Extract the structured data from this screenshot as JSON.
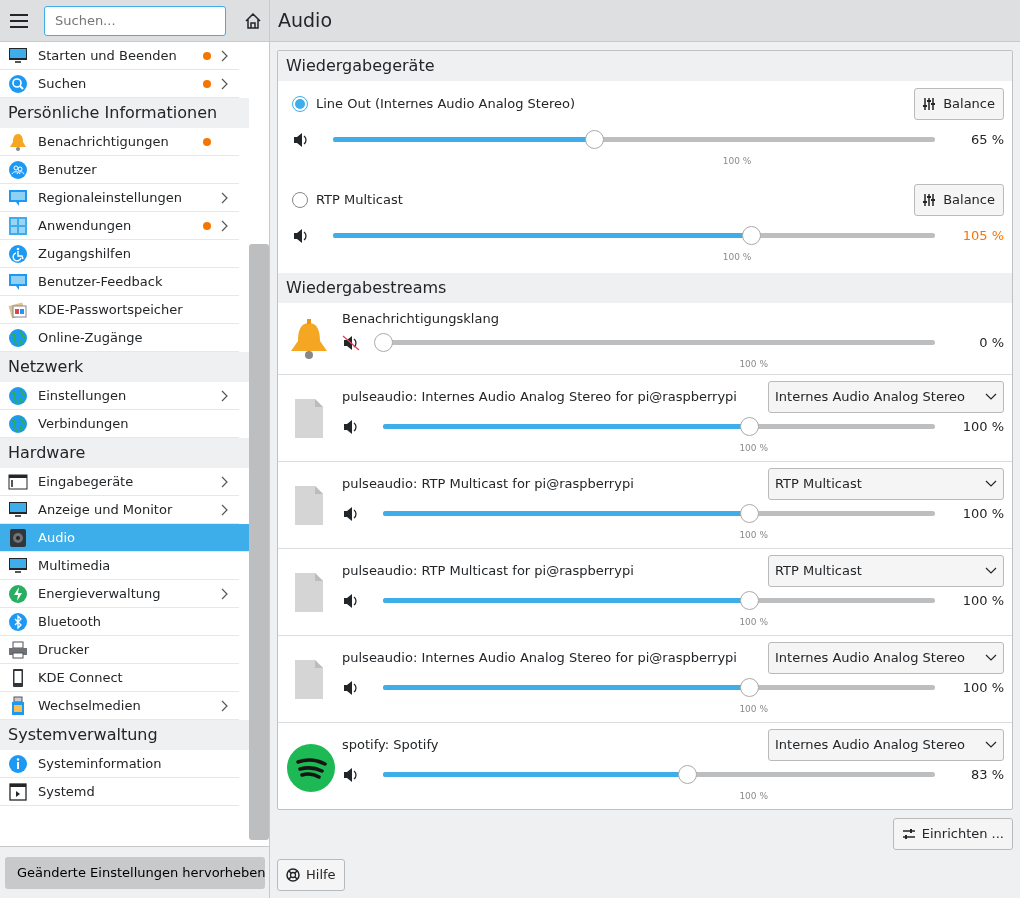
{
  "toolbar": {
    "search": {
      "placeholder": "Suchen..."
    }
  },
  "page_title": "Audio",
  "sidebar": {
    "groups": [
      {
        "items": [
          {
            "label": "Starten und Beenden",
            "notify": true,
            "chevron": true,
            "selected": false
          },
          {
            "label": "Suchen",
            "notify": true,
            "chevron": true,
            "selected": false
          }
        ]
      },
      {
        "title": "Persönliche Informationen",
        "items": [
          {
            "label": "Benachrichtigungen",
            "notify": true,
            "chevron": false,
            "selected": false
          },
          {
            "label": "Benutzer",
            "notify": false,
            "chevron": false,
            "selected": false
          },
          {
            "label": "Regionaleinstellungen",
            "notify": false,
            "chevron": true,
            "selected": false
          },
          {
            "label": "Anwendungen",
            "notify": true,
            "chevron": true,
            "selected": false
          },
          {
            "label": "Zugangshilfen",
            "notify": false,
            "chevron": false,
            "selected": false
          },
          {
            "label": "Benutzer-Feedback",
            "notify": false,
            "chevron": false,
            "selected": false
          },
          {
            "label": "KDE-Passwortspeicher",
            "notify": false,
            "chevron": false,
            "selected": false
          },
          {
            "label": "Online-Zugänge",
            "notify": false,
            "chevron": false,
            "selected": false
          }
        ]
      },
      {
        "title": "Netzwerk",
        "items": [
          {
            "label": "Einstellungen",
            "notify": false,
            "chevron": true,
            "selected": false
          },
          {
            "label": "Verbindungen",
            "notify": false,
            "chevron": false,
            "selected": false
          }
        ]
      },
      {
        "title": "Hardware",
        "items": [
          {
            "label": "Eingabegeräte",
            "notify": false,
            "chevron": true,
            "selected": false
          },
          {
            "label": "Anzeige und Monitor",
            "notify": false,
            "chevron": true,
            "selected": false
          },
          {
            "label": "Audio",
            "notify": false,
            "chevron": false,
            "selected": true
          },
          {
            "label": "Multimedia",
            "notify": false,
            "chevron": false,
            "selected": false
          },
          {
            "label": "Energieverwaltung",
            "notify": false,
            "chevron": true,
            "selected": false
          },
          {
            "label": "Bluetooth",
            "notify": false,
            "chevron": false,
            "selected": false
          },
          {
            "label": "Drucker",
            "notify": false,
            "chevron": false,
            "selected": false
          },
          {
            "label": "KDE Connect",
            "notify": false,
            "chevron": false,
            "selected": false
          },
          {
            "label": "Wechselmedien",
            "notify": false,
            "chevron": true,
            "selected": false
          }
        ]
      },
      {
        "title": "Systemverwaltung",
        "items": [
          {
            "label": "Systeminformation",
            "notify": false,
            "chevron": false,
            "selected": false
          },
          {
            "label": "Systemd",
            "notify": false,
            "chevron": false,
            "selected": false
          }
        ]
      }
    ]
  },
  "devices": {
    "title": "Wiedergabegeräte",
    "items": [
      {
        "label": "Line Out (Internes Audio Analog Stereo)",
        "selected": true,
        "balance": "Balance",
        "muted": false,
        "level": 0.434,
        "reading": "65 %",
        "over": false,
        "mark": "100 %"
      },
      {
        "label": "RTP Multicast",
        "selected": false,
        "balance": "Balance",
        "muted": false,
        "level": 0.695,
        "reading": "105 %",
        "over": true,
        "mark": "100 %"
      }
    ]
  },
  "streams": {
    "title": "Wiedergabestreams",
    "items": [
      {
        "kind": "bell",
        "name": "Benachrichtigungsklang",
        "muted": true,
        "level": 0,
        "reading": "0 %",
        "mark": "100 %"
      },
      {
        "kind": "file",
        "name": "pulseaudio: Internes Audio Analog Stereo for pi@raspberrypi",
        "device": "Internes Audio Analog Stereo",
        "muted": false,
        "level": 0.663,
        "reading": "100 %",
        "mark": "100 %"
      },
      {
        "kind": "file",
        "name": "pulseaudio: RTP Multicast for pi@raspberrypi",
        "device": "RTP Multicast",
        "muted": false,
        "level": 0.663,
        "reading": "100 %",
        "mark": "100 %"
      },
      {
        "kind": "file",
        "name": "pulseaudio: RTP Multicast for pi@raspberrypi",
        "device": "RTP Multicast",
        "muted": false,
        "level": 0.663,
        "reading": "100 %",
        "mark": "100 %"
      },
      {
        "kind": "file",
        "name": "pulseaudio: Internes Audio Analog Stereo for pi@raspberrypi",
        "device": "Internes Audio Analog Stereo",
        "muted": false,
        "level": 0.663,
        "reading": "100 %",
        "mark": "100 %"
      },
      {
        "kind": "spotify",
        "name": "spotify: Spotify",
        "device": "Internes Audio Analog Stereo",
        "muted": false,
        "level": 0.55,
        "reading": "83 %",
        "mark": "100 %"
      }
    ]
  },
  "buttons": {
    "configure": "Einrichten ...",
    "help": "Hilfe",
    "highlight": "Geänderte Einstellungen hervorheben"
  }
}
